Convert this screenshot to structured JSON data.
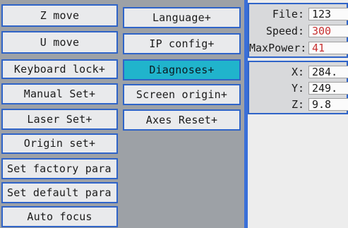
{
  "menu": {
    "left": [
      {
        "label": "Z move"
      },
      {
        "label": "U move"
      },
      {
        "label": "Keyboard lock+"
      },
      {
        "label": "Manual Set+"
      },
      {
        "label": "Laser Set+"
      },
      {
        "label": "Origin set+"
      },
      {
        "label": "Set factory para"
      },
      {
        "label": "Set default para"
      },
      {
        "label": "Auto focus"
      }
    ],
    "right": [
      {
        "label": "Language+"
      },
      {
        "label": "IP config+"
      },
      {
        "label": "Diagnoses+",
        "selected": true
      },
      {
        "label": "Screen origin+"
      },
      {
        "label": "Axes Reset+"
      }
    ]
  },
  "status": {
    "file_label": "File:",
    "file_value": "123",
    "speed_label": "Speed:",
    "speed_value": "300",
    "maxpower_label": "MaxPower:",
    "maxpower_value": "41",
    "x_label": "X:",
    "x_value": "284.",
    "y_label": "Y:",
    "y_value": "249.",
    "z_label": "Z:",
    "z_value": "9.8"
  },
  "colors": {
    "accent_blue": "#2f64c8",
    "selected_cyan": "#20b4cc",
    "value_red": "#c83232"
  }
}
